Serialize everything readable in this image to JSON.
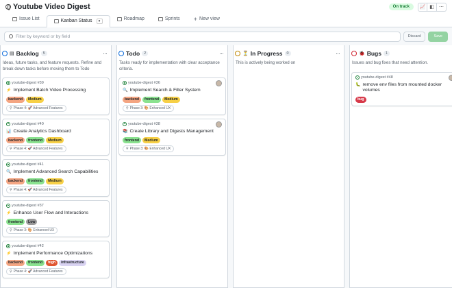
{
  "app": {
    "title": "Youtube Video Digest",
    "status": "On track"
  },
  "tabs": [
    {
      "label": "Issue List"
    },
    {
      "label": "Kanban Status"
    },
    {
      "label": "Roadmap"
    },
    {
      "label": "Sprints"
    },
    {
      "label": "New view"
    }
  ],
  "filter": {
    "placeholder": "Filter by keyword or by field",
    "discard_label": "Discard",
    "save_label": "Save"
  },
  "colors": {
    "accent_green": "#1a7f37",
    "backlog": "#0969da",
    "todo": "#0969da",
    "in_progress": "#bf8700",
    "bugs": "#cf222e"
  },
  "columns": [
    {
      "name": "Backlog",
      "count": "5",
      "status_color": "#0969da",
      "icon": "▤",
      "description": "Ideas, future tasks, and feature requests. Refine and break down tasks before moving them to Todo",
      "cards": [
        {
          "repo": "youtube-digest #39",
          "emoji": "⚡",
          "title": "Implement Batch Video Processing",
          "labels": [
            {
              "text": "backend",
              "cls": "backend"
            },
            {
              "text": "Medium",
              "cls": "medium"
            }
          ],
          "phase": "Phase 4: 🚀 Advanced Features"
        },
        {
          "repo": "youtube-digest #40",
          "emoji": "📊",
          "title": "Create Analytics Dashboard",
          "labels": [
            {
              "text": "backend",
              "cls": "backend"
            },
            {
              "text": "frontend",
              "cls": "frontend"
            },
            {
              "text": "Medium",
              "cls": "medium"
            }
          ],
          "phase": "Phase 4: 🚀 Advanced Features"
        },
        {
          "repo": "youtube-digest #41",
          "emoji": "🔍",
          "title": "Implement Advanced Search Capabilities",
          "labels": [
            {
              "text": "backend",
              "cls": "backend"
            },
            {
              "text": "frontend",
              "cls": "frontend"
            },
            {
              "text": "Medium",
              "cls": "medium"
            }
          ],
          "phase": "Phase 4: 🚀 Advanced Features"
        },
        {
          "repo": "youtube-digest #37",
          "emoji": "⚡",
          "title": "Enhance User Flow and Interactions",
          "labels": [
            {
              "text": "frontend",
              "cls": "frontend"
            },
            {
              "text": "Low",
              "cls": "low"
            }
          ],
          "phase": "Phase 3: 🎨 Enhanced UX"
        },
        {
          "repo": "youtube-digest #42",
          "emoji": "⚡",
          "title": "Implement Performance Optimizations",
          "labels": [
            {
              "text": "backend",
              "cls": "backend"
            },
            {
              "text": "frontend",
              "cls": "frontend"
            },
            {
              "text": "high",
              "cls": "high"
            },
            {
              "text": "infrastructure",
              "cls": "infrastructure"
            }
          ],
          "phase": "Phase 4: 🚀 Advanced Features"
        }
      ]
    },
    {
      "name": "Todo",
      "count": "2",
      "status_color": "#0969da",
      "icon": "",
      "description": "Tasks ready for implementation with clear acceptance criteria.",
      "cards": [
        {
          "repo": "youtube-digest #36",
          "emoji": "🔍",
          "title": "Implement Search & Filter System",
          "labels": [
            {
              "text": "backend",
              "cls": "backend"
            },
            {
              "text": "frontend",
              "cls": "frontend"
            },
            {
              "text": "Medium",
              "cls": "medium"
            }
          ],
          "phase": "Phase 3: 🎨 Enhanced UX",
          "avatar": true
        },
        {
          "repo": "youtube-digest #38",
          "emoji": "📚",
          "title": "Create Library and Digests Management",
          "labels": [
            {
              "text": "frontend",
              "cls": "frontend"
            },
            {
              "text": "Medium",
              "cls": "medium"
            }
          ],
          "phase": "Phase 3: 🎨 Enhanced UX",
          "avatar": true
        }
      ]
    },
    {
      "name": "In Progress",
      "count": "0",
      "status_color": "#bf8700",
      "icon": "⏳",
      "description": "This is actively being worked on",
      "cards": []
    },
    {
      "name": "Bugs",
      "count": "1",
      "status_color": "#cf222e",
      "icon": "🐞",
      "description": "Issues and bug fixes that need attention.",
      "cards": [
        {
          "repo": "youtube-digest #48",
          "emoji": "🐛",
          "title": "remove env files from mounted docker volumes",
          "labels": [
            {
              "text": "bug",
              "cls": "bug"
            }
          ],
          "phase": "",
          "avatar": true
        }
      ]
    }
  ]
}
